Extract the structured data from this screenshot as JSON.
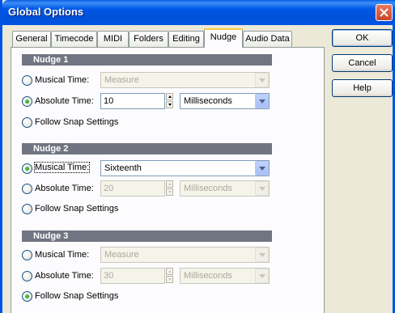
{
  "window": {
    "title": "Global Options"
  },
  "tabs": [
    {
      "label": "General"
    },
    {
      "label": "Timecode"
    },
    {
      "label": "MIDI"
    },
    {
      "label": "Folders"
    },
    {
      "label": "Editing"
    },
    {
      "label": "Nudge",
      "active": true
    },
    {
      "label": "Audio Data"
    }
  ],
  "buttons": {
    "ok": "OK",
    "cancel": "Cancel",
    "help": "Help"
  },
  "nudges": [
    {
      "header": "Nudge 1",
      "musical_label": "Musical Time:",
      "musical_value": "Measure",
      "absolute_label": "Absolute Time:",
      "absolute_value": "10",
      "absolute_unit": "Milliseconds",
      "follow_label": "Follow Snap Settings",
      "selected": "absolute"
    },
    {
      "header": "Nudge 2",
      "musical_label": "Musical Time:",
      "musical_value": "Sixteenth",
      "absolute_label": "Absolute Time:",
      "absolute_value": "20",
      "absolute_unit": "Milliseconds",
      "follow_label": "Follow Snap Settings",
      "selected": "musical"
    },
    {
      "header": "Nudge 3",
      "musical_label": "Musical Time:",
      "musical_value": "Measure",
      "absolute_label": "Absolute Time:",
      "absolute_value": "30",
      "absolute_unit": "Milliseconds",
      "follow_label": "Follow Snap Settings",
      "selected": "follow"
    }
  ],
  "colors": {
    "titlebar": "#0054E3",
    "section_header": "#717581",
    "dialog_bg": "#ECE9D8",
    "radio_checked": "#2E9A2C"
  }
}
